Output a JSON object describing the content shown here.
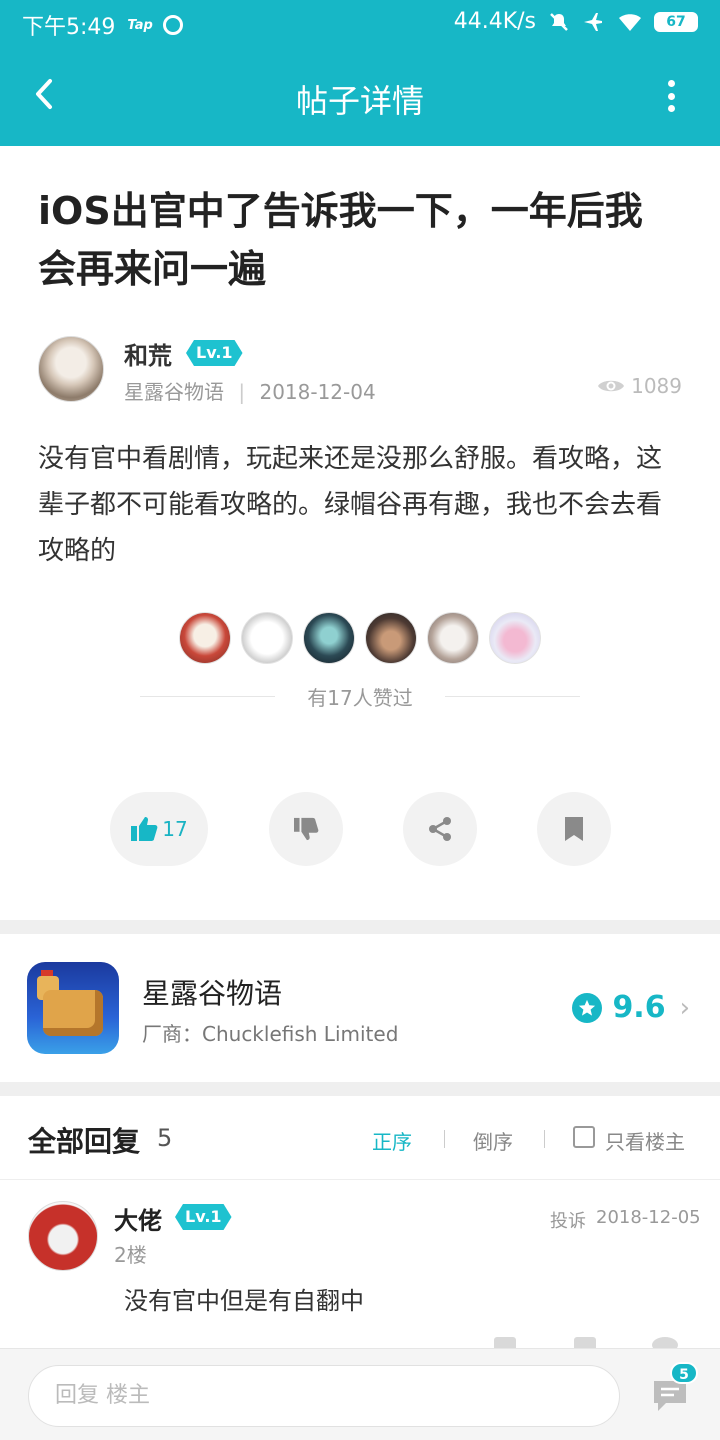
{
  "status_bar": {
    "time": "下午5:49",
    "tap_label": "Tap",
    "network_speed": "44.4K/s",
    "battery": "67"
  },
  "nav": {
    "title": "帖子详情"
  },
  "post": {
    "title": "iOS出官中了告诉我一下，一年后我会再来问一遍",
    "author": {
      "name": "和荒",
      "level": "Lv.1",
      "game": "星露谷物语",
      "meta_separator": "|",
      "date": "2018-12-04"
    },
    "views": "1089",
    "body": "没有官中看剧情，玩起来还是没那么舒服。看攻略，这辈子都不可能看攻略的。绿帽谷再有趣，我也不会去看攻略的",
    "likes_summary": "有17人赞过",
    "like_count": "17"
  },
  "game_card": {
    "name": "星露谷物语",
    "vendor": "厂商：Chucklefish Limited",
    "score": "9.6"
  },
  "replies": {
    "title": "全部回复",
    "count": "5",
    "sort_asc": "正序",
    "sort_desc": "倒序",
    "only_op": "只看楼主",
    "items": [
      {
        "name": "大佬",
        "level": "Lv.1",
        "floor": "2楼",
        "report": "投诉",
        "date": "2018-12-05",
        "text": "没有官中但是有自翻中"
      }
    ]
  },
  "bottom_bar": {
    "placeholder": "回复  楼主",
    "comment_badge": "5"
  },
  "colors": {
    "accent": "#17b7c6",
    "background": "#ffffff",
    "separator": "#efefef"
  },
  "icons": [
    "back-arrow-icon",
    "more-vertical-icon",
    "eye-icon",
    "thumbs-up-icon",
    "thumbs-down-icon",
    "share-icon",
    "bookmark-icon",
    "star-icon",
    "chevron-right-icon",
    "checkbox-icon",
    "comment-icon",
    "mute-icon",
    "airplane-icon",
    "wifi-icon"
  ]
}
